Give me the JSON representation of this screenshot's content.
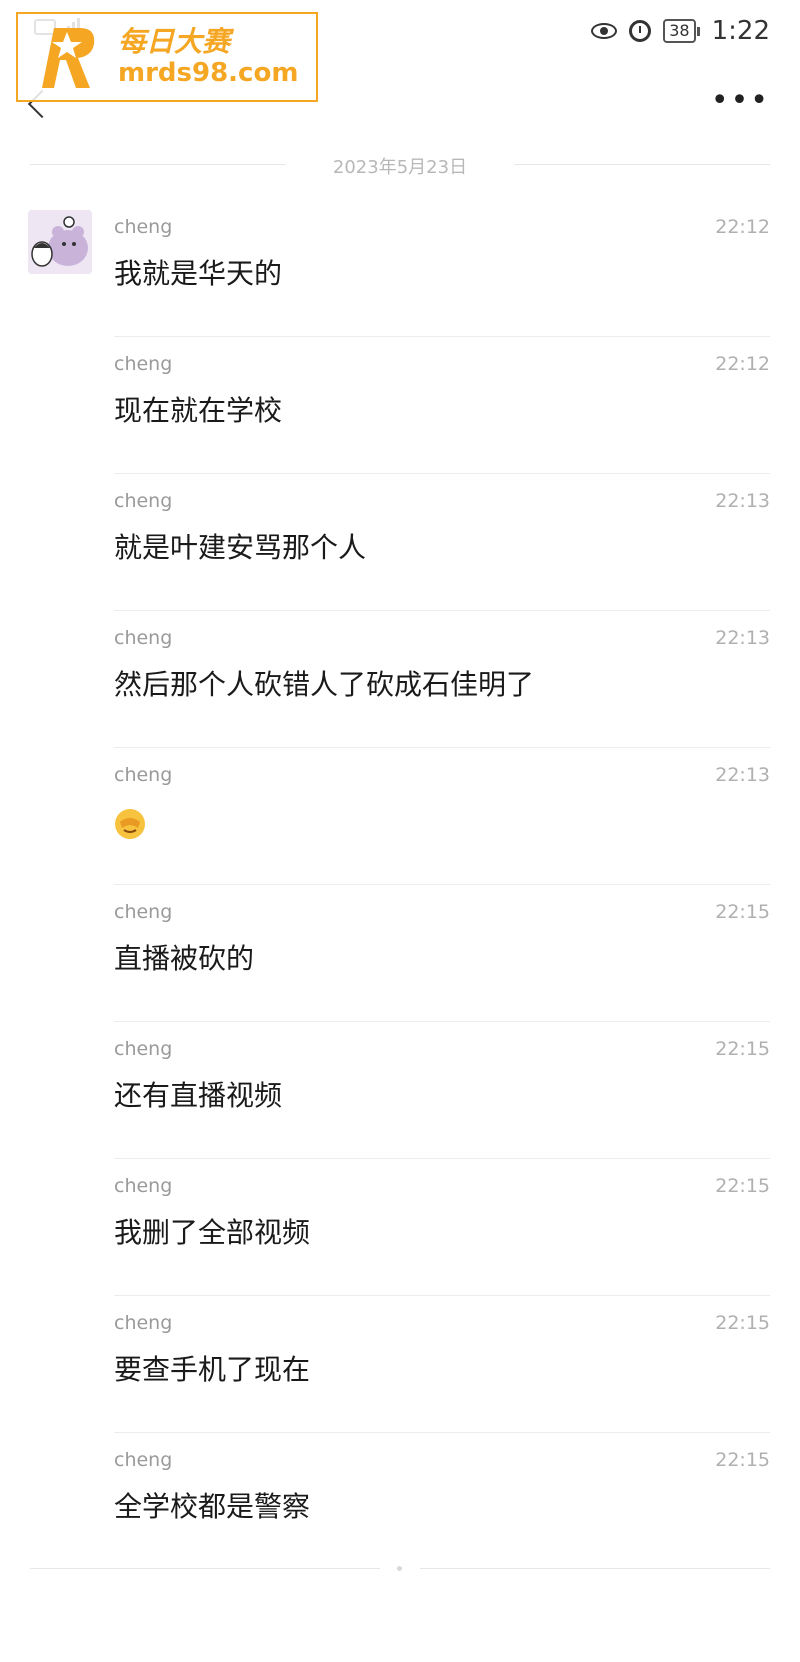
{
  "status_bar": {
    "time": "1:22",
    "battery": "38"
  },
  "watermark": {
    "title": "每日大赛",
    "url": "mrds98.com"
  },
  "chat": {
    "date": "2023年5月23日",
    "messages": [
      {
        "sender": "cheng",
        "time": "22:12",
        "text": "我就是华天的"
      },
      {
        "sender": "cheng",
        "time": "22:12",
        "text": "现在就在学校"
      },
      {
        "sender": "cheng",
        "time": "22:13",
        "text": "就是叶建安骂那个人"
      },
      {
        "sender": "cheng",
        "time": "22:13",
        "text": "然后那个人砍错人了砍成石佳明了"
      },
      {
        "sender": "cheng",
        "time": "22:13",
        "text": "",
        "emoji": "facepalm-emoji-icon"
      },
      {
        "sender": "cheng",
        "time": "22:15",
        "text": "直播被砍的"
      },
      {
        "sender": "cheng",
        "time": "22:15",
        "text": "还有直播视频"
      },
      {
        "sender": "cheng",
        "time": "22:15",
        "text": "我删了全部视频"
      },
      {
        "sender": "cheng",
        "time": "22:15",
        "text": "要查手机了现在"
      },
      {
        "sender": "cheng",
        "time": "22:15",
        "text": "全学校都是警察"
      }
    ]
  }
}
